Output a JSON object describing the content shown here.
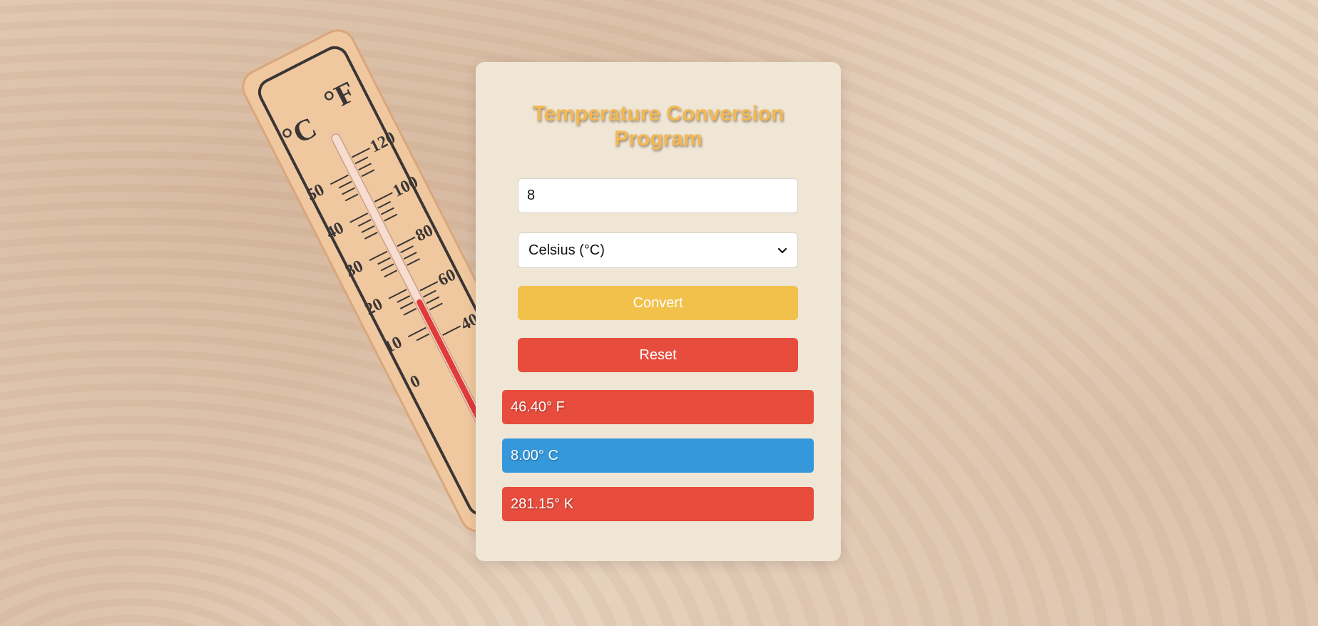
{
  "app": {
    "title_line1": "Temperature Conversion",
    "title_line2": "Program"
  },
  "form": {
    "temperature_value": "8",
    "unit_selected": "Celsius (°C)",
    "convert_label": "Convert",
    "reset_label": "Reset"
  },
  "results": {
    "fahrenheit": "46.40° F",
    "celsius": "8.00° C",
    "kelvin": "281.15° K"
  },
  "colors": {
    "title": "#f2b852",
    "convert": "#f2c14b",
    "reset": "#e74c3c",
    "result_fahrenheit": "#e74c3c",
    "result_celsius": "#3498db",
    "result_kelvin": "#e74c3c",
    "card": "#f0e6d6"
  },
  "background": {
    "thermometer_scale_celsius": [
      "50",
      "40",
      "30",
      "20",
      "10",
      "0"
    ],
    "thermometer_scale_fahrenheit": [
      "120",
      "100",
      "80",
      "60",
      "40"
    ],
    "thermometer_unit_celsius": "°C",
    "thermometer_unit_fahrenheit": "°F"
  }
}
